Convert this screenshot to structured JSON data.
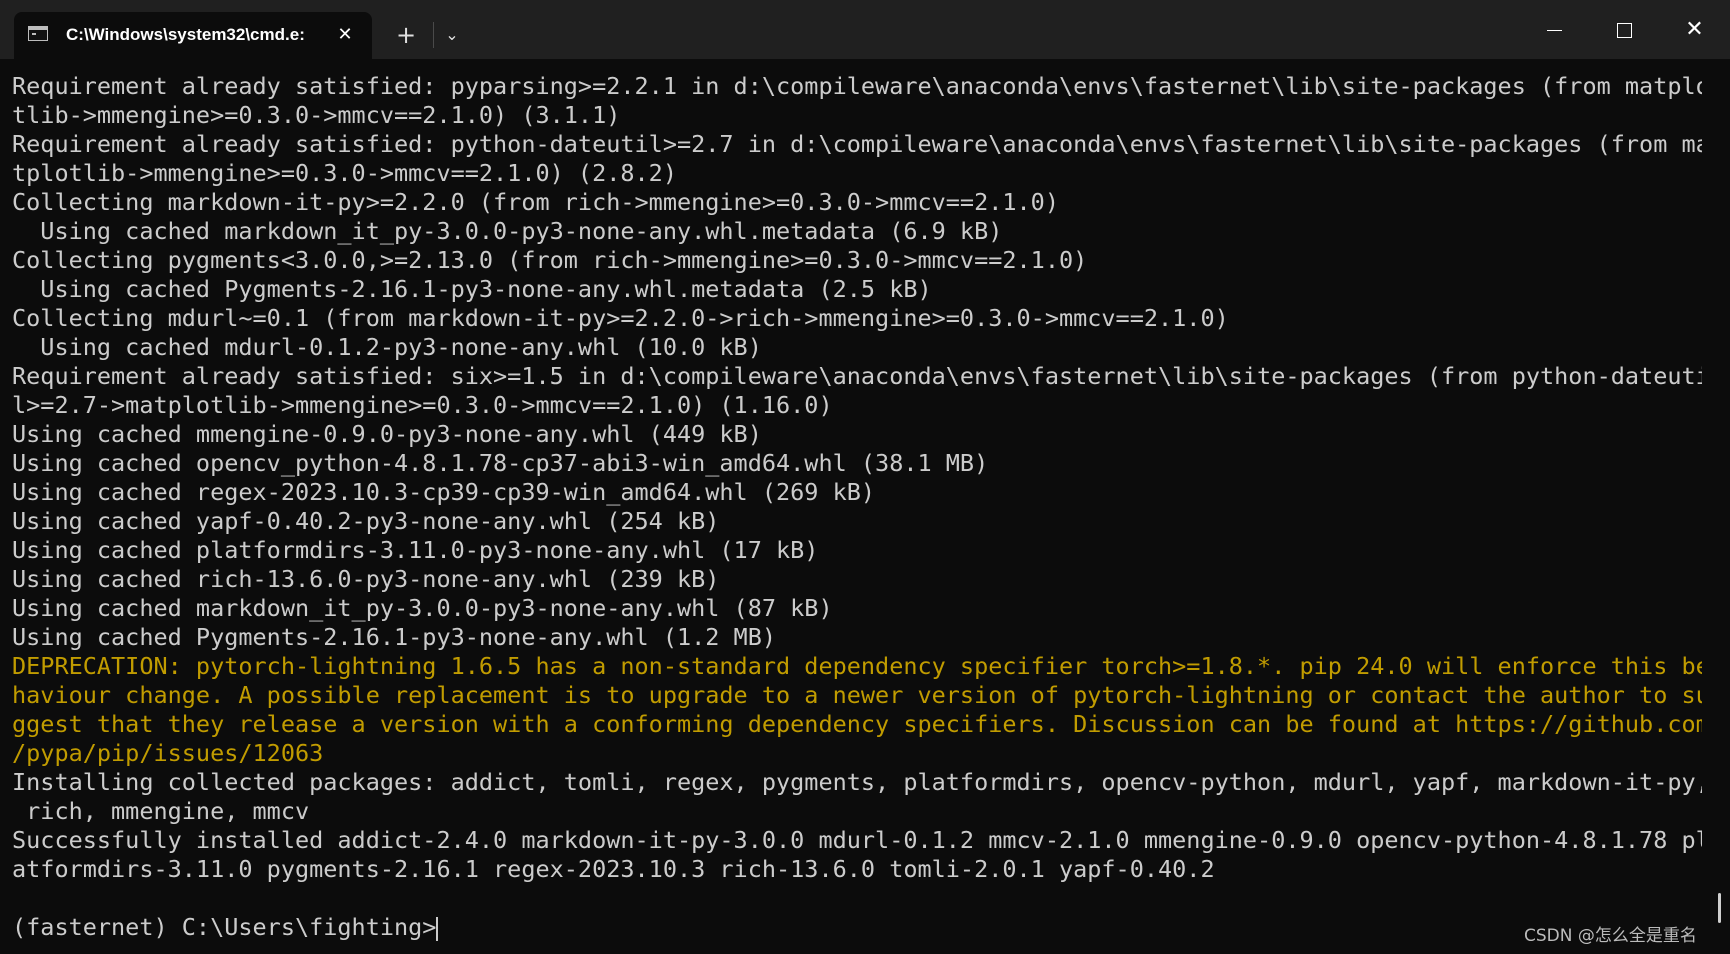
{
  "window": {
    "tab_title": "C:\\Windows\\system32\\cmd.e:",
    "new_tab_glyph": "+",
    "dropdown_glyph": "⌄",
    "close_tab_glyph": "✕",
    "close_window_glyph": "✕"
  },
  "colors": {
    "background": "#0c0c0c",
    "titlebar": "#202020",
    "text": "#cccccc",
    "warning": "#c19c00"
  },
  "console": {
    "lines": [
      "Requirement already satisfied: pyparsing>=2.2.1 in d:\\compileware\\anaconda\\envs\\fasternet\\lib\\site-packages (from matplo",
      "tlib->mmengine>=0.3.0->mmcv==2.1.0) (3.1.1)",
      "Requirement already satisfied: python-dateutil>=2.7 in d:\\compileware\\anaconda\\envs\\fasternet\\lib\\site-packages (from ma",
      "tplotlib->mmengine>=0.3.0->mmcv==2.1.0) (2.8.2)",
      "Collecting markdown-it-py>=2.2.0 (from rich->mmengine>=0.3.0->mmcv==2.1.0)",
      "  Using cached markdown_it_py-3.0.0-py3-none-any.whl.metadata (6.9 kB)",
      "Collecting pygments<3.0.0,>=2.13.0 (from rich->mmengine>=0.3.0->mmcv==2.1.0)",
      "  Using cached Pygments-2.16.1-py3-none-any.whl.metadata (2.5 kB)",
      "Collecting mdurl~=0.1 (from markdown-it-py>=2.2.0->rich->mmengine>=0.3.0->mmcv==2.1.0)",
      "  Using cached mdurl-0.1.2-py3-none-any.whl (10.0 kB)",
      "Requirement already satisfied: six>=1.5 in d:\\compileware\\anaconda\\envs\\fasternet\\lib\\site-packages (from python-dateuti",
      "l>=2.7->matplotlib->mmengine>=0.3.0->mmcv==2.1.0) (1.16.0)",
      "Using cached mmengine-0.9.0-py3-none-any.whl (449 kB)",
      "Using cached opencv_python-4.8.1.78-cp37-abi3-win_amd64.whl (38.1 MB)",
      "Using cached regex-2023.10.3-cp39-cp39-win_amd64.whl (269 kB)",
      "Using cached yapf-0.40.2-py3-none-any.whl (254 kB)",
      "Using cached platformdirs-3.11.0-py3-none-any.whl (17 kB)",
      "Using cached rich-13.6.0-py3-none-any.whl (239 kB)",
      "Using cached markdown_it_py-3.0.0-py3-none-any.whl (87 kB)",
      "Using cached Pygments-2.16.1-py3-none-any.whl (1.2 MB)",
      "DEPRECATION: pytorch-lightning 1.6.5 has a non-standard dependency specifier torch>=1.8.*. pip 24.0 will enforce this be",
      "haviour change. A possible replacement is to upgrade to a newer version of pytorch-lightning or contact the author to su",
      "ggest that they release a version with a conforming dependency specifiers. Discussion can be found at https://github.com",
      "/pypa/pip/issues/12063",
      "Installing collected packages: addict, tomli, regex, pygments, platformdirs, opencv-python, mdurl, yapf, markdown-it-py,",
      " rich, mmengine, mmcv",
      "Successfully installed addict-2.4.0 markdown-it-py-3.0.0 mdurl-0.1.2 mmcv-2.1.0 mmengine-0.9.0 opencv-python-4.8.1.78 pl",
      "atformdirs-3.11.0 pygments-2.16.1 regex-2023.10.3 rich-13.6.0 tomli-2.0.1 yapf-0.40.2",
      "",
      "(fasternet) C:\\Users\\fighting>"
    ],
    "warning_lines": [
      20,
      21,
      22,
      23
    ],
    "prompt_line": 29
  },
  "watermark": "CSDN @怎么全是重名"
}
